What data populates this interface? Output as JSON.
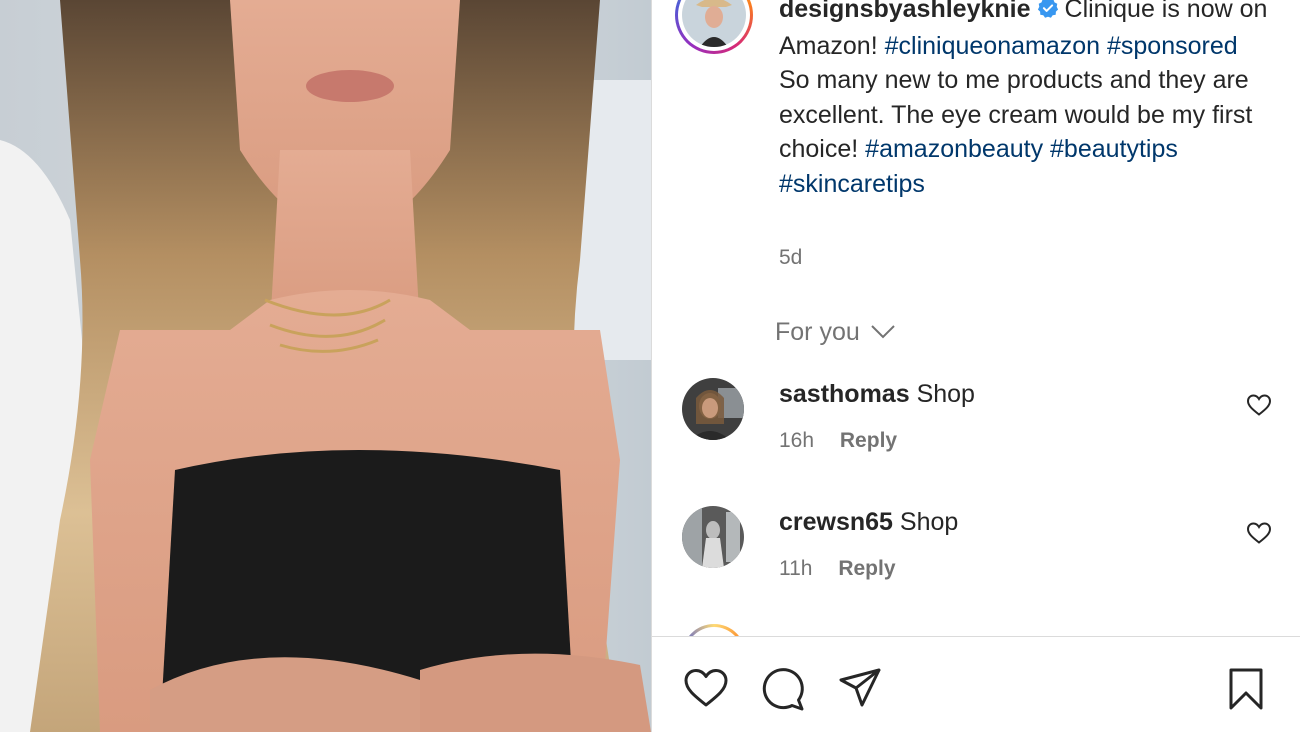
{
  "post": {
    "username": "designsbyashleyknie",
    "caption_text": "Clinique is now on Amazon!",
    "caption_tags_1": "#cliniqueonamazon #sponsored",
    "caption_body": "So many new to me products and they are excellent. The eye cream would be my first choice!",
    "caption_tags_2": "#amazonbeauty #beautytips #skincaretips",
    "time": "5d",
    "verified": true
  },
  "comments_filter": {
    "label": "For you"
  },
  "comments": [
    {
      "username": "sasthomas",
      "text": "Shop",
      "time": "16h",
      "reply_label": "Reply"
    },
    {
      "username": "crewsn65",
      "text": "Shop",
      "time": "11h",
      "reply_label": "Reply"
    }
  ],
  "colors": {
    "accent_link": "#00376b",
    "verified_blue": "#3897f0",
    "muted": "#737373",
    "text": "#262626"
  },
  "icons": [
    "heart-icon",
    "comment-icon",
    "share-icon",
    "bookmark-icon",
    "chevron-down-icon",
    "verified-icon"
  ]
}
